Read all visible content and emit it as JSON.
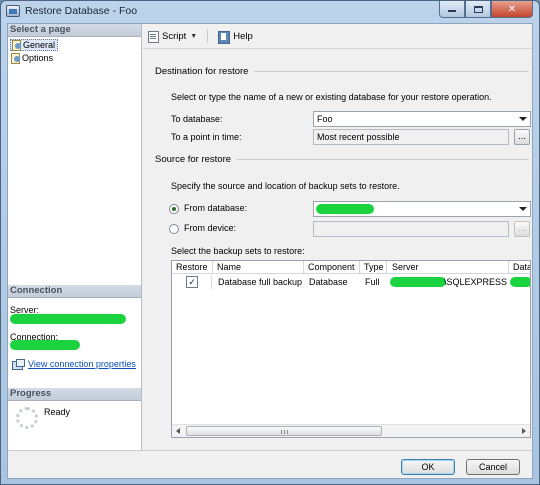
{
  "window": {
    "title": "Restore Database - Foo"
  },
  "left": {
    "select_page_header": "Select a page",
    "pages": [
      {
        "label": "General",
        "selected": true
      },
      {
        "label": "Options",
        "selected": false
      }
    ],
    "connection_header": "Connection",
    "server_label": "Server:",
    "connection_label": "Connection:",
    "view_connection_link": "View connection properties",
    "progress_header": "Progress",
    "progress_status": "Ready"
  },
  "toolbar": {
    "script_label": "Script",
    "help_label": "Help"
  },
  "destination": {
    "title": "Destination for restore",
    "description": "Select or type the name of a new or existing database for your restore operation.",
    "to_database_label": "To database:",
    "to_database_value": "Foo",
    "point_in_time_label": "To a point in time:",
    "point_in_time_value": "Most recent possible",
    "browse_label": "..."
  },
  "source": {
    "title": "Source for restore",
    "description": "Specify the source and location of backup sets to restore.",
    "from_database_label": "From database:",
    "from_device_label": "From device:",
    "browse_label": "...",
    "backup_sets_label": "Select the backup sets to restore:"
  },
  "backup_grid": {
    "columns": [
      "Restore",
      "Name",
      "Component",
      "Type",
      "Server",
      "Datab"
    ],
    "rows": [
      {
        "restore": "✓",
        "name": "Database full backup",
        "component": "Database",
        "type": "Full",
        "server": "\\SQLEXPRESS"
      }
    ]
  },
  "buttons": {
    "ok": "OK",
    "cancel": "Cancel"
  },
  "colors": {
    "redaction": "#1bd33e",
    "link": "#0b4fb7",
    "window_frame": "#a9c4df"
  }
}
